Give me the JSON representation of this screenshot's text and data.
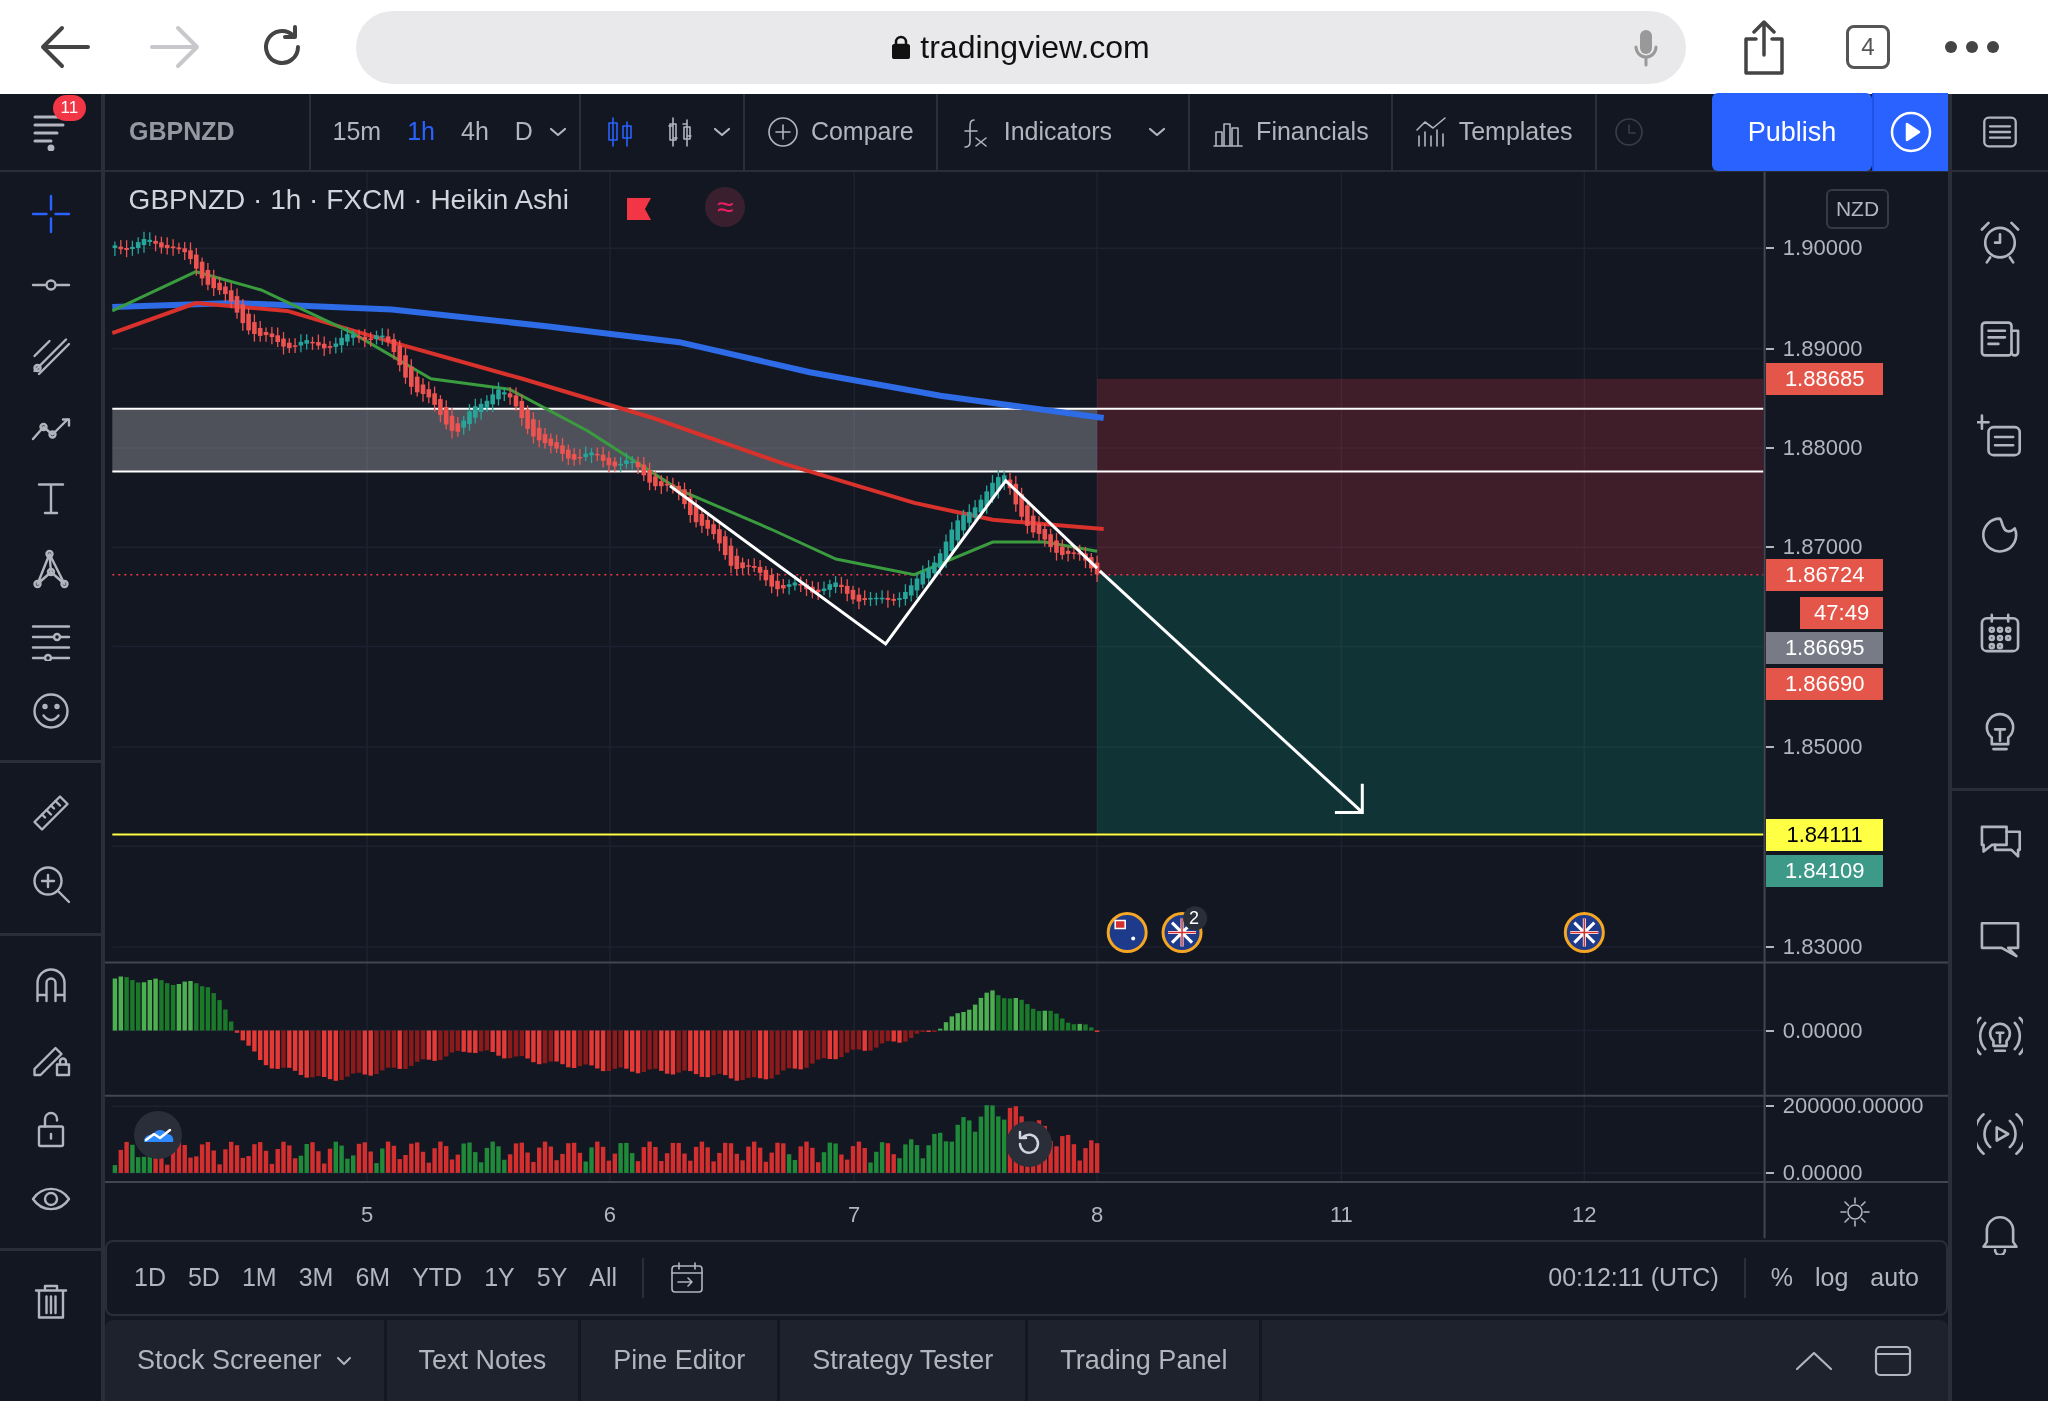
{
  "browser": {
    "url": "tradingview.com",
    "tab_count": "4",
    "forward_disabled": true
  },
  "toolbar": {
    "menu_badge": "11",
    "symbol": "GBPNZD",
    "timeframes": [
      {
        "label": "15m",
        "selected": false
      },
      {
        "label": "1h",
        "selected": true
      },
      {
        "label": "4h",
        "selected": false
      },
      {
        "label": "D",
        "selected": false
      }
    ],
    "chart_types": [
      {
        "kind": "candles",
        "selected": true
      },
      {
        "kind": "bars",
        "selected": false
      }
    ],
    "buttons": [
      {
        "kind": "compare",
        "label": "Compare",
        "menu": false
      },
      {
        "kind": "indicators",
        "label": "Indicators",
        "menu": true
      },
      {
        "kind": "financials",
        "label": "Financials",
        "menu": false
      },
      {
        "kind": "templates",
        "label": "Templates",
        "menu": false
      }
    ],
    "publish": "Publish"
  },
  "left_toolbar": {
    "tools": [
      {
        "selected": true
      },
      {
        "selected": false
      },
      {
        "selected": false
      },
      {
        "selected": false
      },
      {
        "selected": false
      },
      {
        "selected": false
      },
      {
        "selected": false
      },
      {
        "selected": false
      },
      {
        "selected": false
      },
      {
        "selected": false
      },
      {
        "selected": false
      },
      {
        "selected": false
      },
      {
        "selected": false
      },
      {
        "selected": false
      },
      {
        "selected": false
      }
    ]
  },
  "chart": {
    "legend": "GBPNZD · 1h · FXCM · Heikin Ashi",
    "legend_icon": "≈",
    "currency": "NZD",
    "price_axis": [
      {
        "text": "1.90000",
        "kind": "tick"
      },
      {
        "text": "1.89000",
        "kind": "tick"
      },
      {
        "text": "1.88685",
        "kind": "badge",
        "color": "#e5564a"
      },
      {
        "text": "1.88000",
        "kind": "tick"
      },
      {
        "text": "1.87000",
        "kind": "tick"
      },
      {
        "text": "1.86724",
        "kind": "badge",
        "color": "#e5564a"
      },
      {
        "text": "47:49",
        "kind": "countdown",
        "color": "#e5564a"
      },
      {
        "text": "1.86695",
        "kind": "badge",
        "color": "#787b86"
      },
      {
        "text": "1.86690",
        "kind": "badge",
        "color": "#e5564a"
      },
      {
        "text": "1.85000",
        "kind": "tick"
      },
      {
        "text": "1.84111",
        "kind": "badge",
        "color": "#ffff44"
      },
      {
        "text": "1.84109",
        "kind": "badge",
        "color": "#3d9a88"
      },
      {
        "text": "1.83000",
        "kind": "tick"
      },
      {
        "text": "0.00000",
        "kind": "tick"
      },
      {
        "text": "200000.00000",
        "kind": "tick"
      },
      {
        "text": "0.00000",
        "kind": "tick"
      }
    ],
    "date_axis": [
      "5",
      "6",
      "7",
      "8",
      "11",
      "12"
    ],
    "event_badge": "2"
  },
  "range_bar": {
    "ranges": [
      "1D",
      "5D",
      "1M",
      "3M",
      "6M",
      "YTD",
      "1Y",
      "5Y",
      "All"
    ],
    "time": "00:12:11 (UTC)",
    "scale_options": [
      "%",
      "log",
      "auto"
    ]
  },
  "bottom_tabs": [
    {
      "label": "Stock Screener",
      "menu": true
    },
    {
      "label": "Text Notes",
      "menu": false
    },
    {
      "label": "Pine Editor",
      "menu": false
    },
    {
      "label": "Strategy Tester",
      "menu": false
    },
    {
      "label": "Trading Panel",
      "menu": false
    }
  ]
}
